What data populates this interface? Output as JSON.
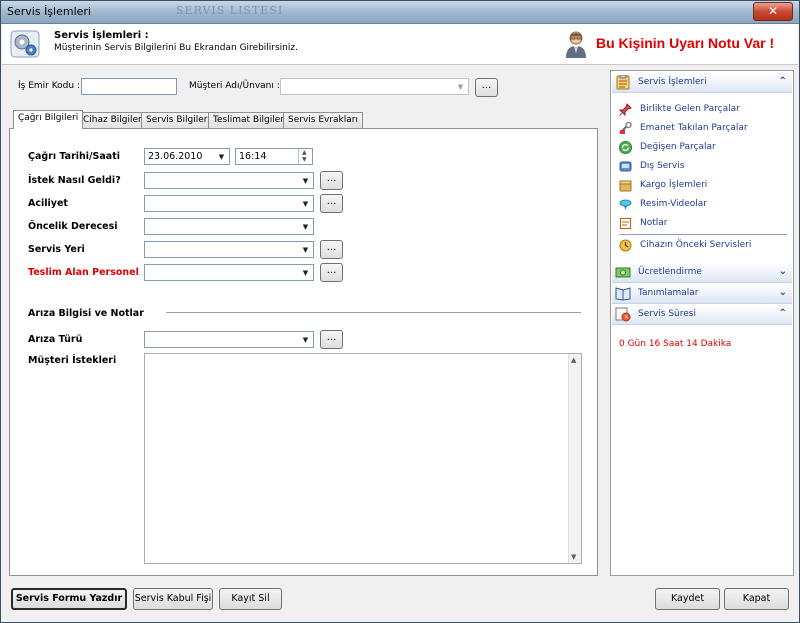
{
  "window": {
    "title": "Servis İşlemleri",
    "ghost_title": "SERVIS LISTESI",
    "close_label": "✕"
  },
  "header": {
    "title": "Servis İşlemleri :",
    "subtitle": "Müşterinin Servis Bilgilerini Bu Ekrandan Girebilirsiniz.",
    "warning": "Bu Kişinin Uyarı Notu Var !",
    "warning_color": "#e00000"
  },
  "top": {
    "job_code_label": "İş Emir Kodu :",
    "job_code_value": "",
    "customer_label": "Müşteri Adı/Ünvanı  :",
    "customer_value": "",
    "ellipsis": "..."
  },
  "tabs": [
    "Çağrı Bilgileri",
    "Cihaz Bilgileri",
    "Servis Bilgileri",
    "Teslimat Bilgileri",
    "Servis Evrakları"
  ],
  "form": {
    "date_label": "Çağrı Tarihi/Saati",
    "date_value": "23.06.2010",
    "time_value": "16:14",
    "how_label": "İstek Nasıl Geldi?",
    "urgency_label": "Aciliyet",
    "priority_label": "Öncelik Derecesi",
    "place_label": "Servis Yeri",
    "receiver_label": "Teslim Alan Personel",
    "receiver_color": "#e00000",
    "section_label": "Arıza Bilgisi ve Notlar",
    "fault_type_label": "Arıza Türü",
    "requests_label": "Müşteri İstekleri",
    "requests_value": ""
  },
  "sidebar": {
    "groups": [
      {
        "label": "Servis İşlemleri",
        "icon": "clipboard-icon",
        "state": "expanded"
      },
      {
        "label": "Ücretlendirme",
        "icon": "money-icon",
        "state": "collapsed"
      },
      {
        "label": "Tanımlamalar",
        "icon": "book-icon",
        "state": "collapsed"
      },
      {
        "label": "Servis Süresi",
        "icon": "clock-icon",
        "state": "expanded"
      }
    ],
    "items": [
      {
        "label": "Birlikte Gelen Parçalar",
        "icon": "pin-icon"
      },
      {
        "label": "Emanet Takılan Parçalar",
        "icon": "tool-icon"
      },
      {
        "label": "Değişen Parçalar",
        "icon": "swap-icon"
      },
      {
        "label": "Dış Servis",
        "icon": "truck-icon"
      },
      {
        "label": "Kargo İşlemleri",
        "icon": "box-icon"
      },
      {
        "label": "Resim-Videolar",
        "icon": "image-icon"
      },
      {
        "label": "Notlar",
        "icon": "note-icon"
      },
      {
        "label": "Cihazın Önceki Servisleri",
        "icon": "history-icon"
      }
    ],
    "duration": "0 Gün 16 Saat 14 Dakika"
  },
  "buttons": {
    "print": "Servis Formu Yazdır",
    "receipt": "Servis Kabul Fişi",
    "delete": "Kayıt Sil",
    "save": "Kaydet",
    "close": "Kapat"
  }
}
